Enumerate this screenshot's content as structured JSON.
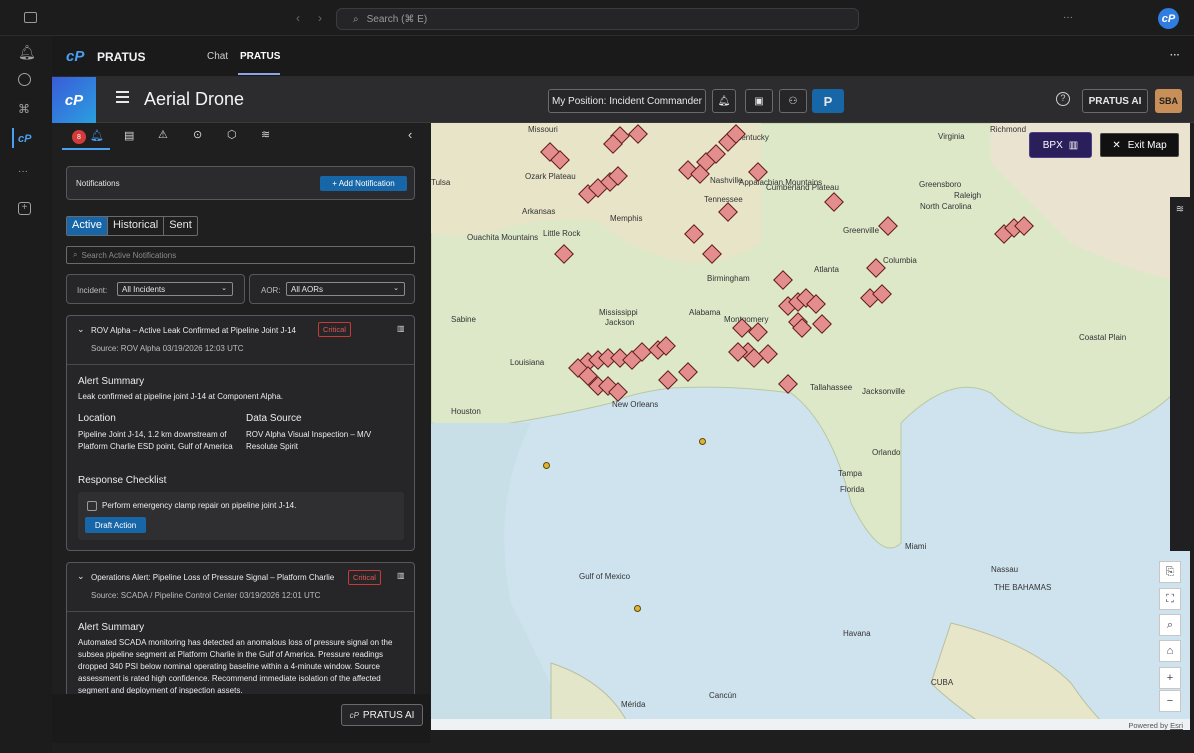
{
  "window": {
    "search_placeholder": "Search (⌘ E)",
    "more_label": "···"
  },
  "app": {
    "brand": "PRATUS",
    "tabs": [
      "Chat",
      "PRATUS"
    ],
    "more_label": "···"
  },
  "toolbar": {
    "title": "Aerial Drone",
    "position_label": "My Position: Incident Commander",
    "p_label": "P",
    "pratus_ai_label": "PRATUS AI",
    "sba_label": "SBA",
    "accent": "#1766a8"
  },
  "panel": {
    "notif_badge": "8",
    "header": "Notifications",
    "add_button": "+ Add Notification",
    "tabs": [
      "Active",
      "Historical",
      "Sent"
    ],
    "search_placeholder": "Search Active Notifications",
    "incident_label": "Incident:",
    "incident_value": "All Incidents",
    "aor_label": "AOR:",
    "aor_value": "All AORs",
    "notifications": [
      {
        "title": "ROV Alpha – Active Leak Confirmed at Pipeline Joint J-14",
        "severity": "Critical",
        "meta": "Source: ROV Alpha   03/19/2026 12:03 UTC",
        "summary_heading": "Alert Summary",
        "summary": "Leak confirmed at pipeline joint J-14 at Component Alpha.",
        "location_heading": "Location",
        "location": "Pipeline Joint J-14, 1.2 km downstream of Platform Charlie ESD point, Gulf of America",
        "source_heading": "Data Source",
        "source": "ROV Alpha Visual Inspection – M/V Resolute Spirit",
        "checklist_heading": "Response Checklist",
        "checklist_item": "Perform emergency clamp repair on pipeline joint J-14.",
        "draft_button": "Draft Action"
      },
      {
        "title": "Operations Alert: Pipeline Loss of Pressure Signal – Platform Charlie",
        "severity": "Critical",
        "meta": "Source: SCADA / Pipeline Control Center   03/19/2026 12:01 UTC",
        "summary_heading": "Alert Summary",
        "summary": "Automated SCADA monitoring has detected an anomalous loss of pressure signal on the subsea pipeline segment at Platform Charlie in the Gulf of America. Pressure readings dropped 340 PSI below nominal operating baseline within a 4-minute window. Source assessment is rated high confidence. Recommend immediate isolation of the affected segment and deployment of inspection assets."
      }
    ],
    "pratus_ai_float": "PRATUS AI"
  },
  "map": {
    "bpx_label": "BPX",
    "exit_label": "Exit Map",
    "attribution": "Powered by",
    "attribution_link": "Esri",
    "cities": [
      {
        "name": "Missouri"
      },
      {
        "name": "Kentucky"
      },
      {
        "name": "Virginia"
      },
      {
        "name": "Richmond"
      },
      {
        "name": "Tulsa"
      },
      {
        "name": "Ozark Plateau"
      },
      {
        "name": "Nashville"
      },
      {
        "name": "Tennessee"
      },
      {
        "name": "Greensboro"
      },
      {
        "name": "Raleigh"
      },
      {
        "name": "North Carolina"
      },
      {
        "name": "Arkansas"
      },
      {
        "name": "Memphis"
      },
      {
        "name": "Little Rock"
      },
      {
        "name": "Ouachita Mountains"
      },
      {
        "name": "Greenville"
      },
      {
        "name": "Columbia"
      },
      {
        "name": "Birmingham"
      },
      {
        "name": "Atlanta"
      },
      {
        "name": "Mississippi"
      },
      {
        "name": "Jackson"
      },
      {
        "name": "Alabama"
      },
      {
        "name": "Montgomery"
      },
      {
        "name": "Louisiana"
      },
      {
        "name": "Tallahassee"
      },
      {
        "name": "Jacksonville"
      },
      {
        "name": "Houston"
      },
      {
        "name": "New Orleans"
      },
      {
        "name": "Orlando"
      },
      {
        "name": "Tampa"
      },
      {
        "name": "Florida"
      },
      {
        "name": "Miami"
      },
      {
        "name": "Gulf of Mexico"
      },
      {
        "name": "Nassau"
      },
      {
        "name": "THE BAHAMAS"
      },
      {
        "name": "Havana"
      },
      {
        "name": "CUBA"
      },
      {
        "name": "Cancún"
      },
      {
        "name": "Mérida"
      },
      {
        "name": "Appalachian Mountains"
      },
      {
        "name": "Cumberland Plateau"
      },
      {
        "name": "Coastal Plain"
      },
      {
        "name": "Sabine"
      }
    ]
  }
}
